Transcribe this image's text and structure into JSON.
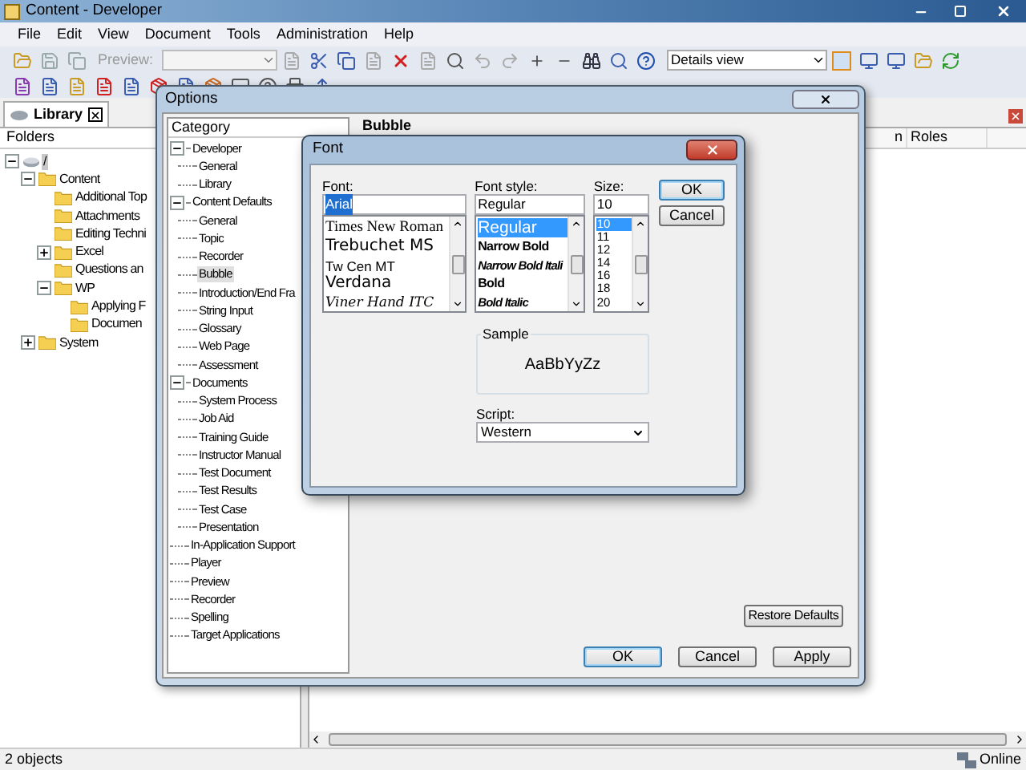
{
  "window": {
    "title": "Content - Developer"
  },
  "menu": [
    "File",
    "Edit",
    "View",
    "Document",
    "Tools",
    "Administration",
    "Help"
  ],
  "toolbar": {
    "preview_label": "Preview:",
    "view_select": "Details view"
  },
  "library_tab": {
    "label": "Library"
  },
  "folders": {
    "header": "Folders",
    "tree": [
      {
        "label": "/",
        "expanded": true,
        "selected": true,
        "children": [
          {
            "label": "Content",
            "expanded": true,
            "selected": false,
            "children": [
              {
                "label": "Additional Top",
                "selected": false
              },
              {
                "label": "Attachments",
                "selected": false
              },
              {
                "label": "Editing Techni",
                "selected": false
              },
              {
                "label": "Excel",
                "expanded": false,
                "selected": false
              },
              {
                "label": "Questions an",
                "selected": false
              },
              {
                "label": "WP",
                "expanded": true,
                "selected": false,
                "children": [
                  {
                    "label": "Applying F",
                    "selected": false
                  },
                  {
                    "label": "Documen",
                    "selected": false
                  }
                ]
              }
            ]
          },
          {
            "label": "System",
            "expanded": false,
            "selected": false
          }
        ]
      }
    ]
  },
  "content_table": {
    "columns": [
      "n",
      "Roles"
    ]
  },
  "status_bar": {
    "left": "2 objects",
    "right": "Online"
  },
  "options_dialog": {
    "title": "Options",
    "category_header": "Category",
    "panel_title": "Bubble",
    "tree": [
      {
        "label": "Developer",
        "expanded": true,
        "selected": false,
        "children": [
          {
            "label": "General",
            "selected": false
          },
          {
            "label": "Library",
            "selected": false
          }
        ]
      },
      {
        "label": "Content Defaults",
        "expanded": true,
        "selected": false,
        "children": [
          {
            "label": "General",
            "selected": false
          },
          {
            "label": "Topic",
            "selected": false
          },
          {
            "label": "Recorder",
            "selected": false
          },
          {
            "label": "Bubble",
            "selected": true
          },
          {
            "label": "Introduction/End Fra",
            "selected": false
          },
          {
            "label": "String Input",
            "selected": false
          },
          {
            "label": "Glossary",
            "selected": false
          },
          {
            "label": "Web Page",
            "selected": false
          },
          {
            "label": "Assessment",
            "selected": false
          }
        ]
      },
      {
        "label": "Documents",
        "expanded": true,
        "selected": false,
        "children": [
          {
            "label": "System Process",
            "selected": false
          },
          {
            "label": "Job Aid",
            "selected": false
          },
          {
            "label": "Training Guide",
            "selected": false
          },
          {
            "label": "Instructor Manual",
            "selected": false
          },
          {
            "label": "Test Document",
            "selected": false
          },
          {
            "label": "Test Results",
            "selected": false
          },
          {
            "label": "Test Case",
            "selected": false
          },
          {
            "label": "Presentation",
            "selected": false
          }
        ]
      },
      {
        "label": "In-Application Support",
        "selected": false
      },
      {
        "label": "Player",
        "selected": false
      },
      {
        "label": "Preview",
        "selected": false
      },
      {
        "label": "Recorder",
        "selected": false
      },
      {
        "label": "Spelling",
        "selected": false
      },
      {
        "label": "Target Applications",
        "selected": false
      }
    ],
    "restore_button": "Restore Defaults",
    "buttons": [
      {
        "label": "OK",
        "default": true
      },
      {
        "label": "Cancel",
        "default": false
      },
      {
        "label": "Apply",
        "default": false
      }
    ]
  },
  "font_dialog": {
    "title": "Font",
    "font": {
      "label": "Font:",
      "value": "Arial",
      "items": [
        {
          "label": "Times New Roman",
          "kind": "serif",
          "selected": false
        },
        {
          "label": "Trebuchet MS",
          "kind": "sans",
          "selected": false
        },
        {
          "label": "Tw Cen MT",
          "kind": "narrow",
          "selected": false
        },
        {
          "label": "Verdana",
          "kind": "sans",
          "selected": false
        },
        {
          "label": "Viner Hand ITC",
          "kind": "script",
          "selected": false
        }
      ]
    },
    "style": {
      "label": "Font style:",
      "value": "Regular",
      "items": [
        {
          "label": "Regular",
          "kind": "regular",
          "selected": true
        },
        {
          "label": "Narrow Bold",
          "kind": "bold",
          "selected": false
        },
        {
          "label": "Narrow Bold Itali",
          "kind": "bold-italic",
          "selected": false
        },
        {
          "label": "Bold",
          "kind": "bold",
          "selected": false
        },
        {
          "label": "Bold Italic",
          "kind": "bold-italic",
          "selected": false
        }
      ]
    },
    "size": {
      "label": "Size:",
      "value": "10",
      "items": [
        {
          "label": "10",
          "selected": true
        },
        {
          "label": "11",
          "selected": false
        },
        {
          "label": "12",
          "selected": false
        },
        {
          "label": "14",
          "selected": false
        },
        {
          "label": "16",
          "selected": false
        },
        {
          "label": "18",
          "selected": false
        },
        {
          "label": "20",
          "selected": false
        }
      ]
    },
    "buttons": [
      {
        "label": "OK",
        "default": true
      },
      {
        "label": "Cancel",
        "default": false
      }
    ],
    "sample_label": "Sample",
    "sample_text": "AaBbYyZz",
    "script_label": "Script:",
    "script_value": "Western"
  }
}
